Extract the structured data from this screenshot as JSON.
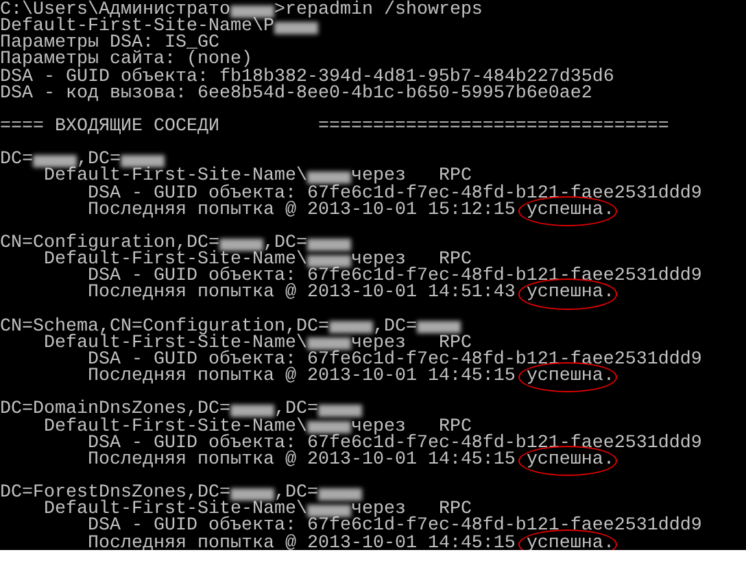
{
  "console": {
    "header": [
      [
        {
          "kind": "text",
          "text": "C:\\Users\\Администрато"
        },
        {
          "kind": "redaction"
        },
        {
          "kind": "text",
          "text": ">repadmin /showreps"
        }
      ],
      [
        {
          "kind": "text",
          "text": "Default-First-Site-Name\\P"
        },
        {
          "kind": "redaction"
        }
      ],
      [
        {
          "kind": "text",
          "text": "Параметры DSA: IS_GC"
        }
      ],
      [
        {
          "kind": "text",
          "text": "Параметры сайта: (none)"
        }
      ],
      [
        {
          "kind": "text",
          "text": "DSA - GUID объекта: fb18b382-394d-4d81-95b7-484b227d35d6"
        }
      ],
      [
        {
          "kind": "text",
          "text": "DSA - код вызова: 6ee8b54d-8ee0-4b1c-b650-59957b6e0ae2"
        }
      ]
    ],
    "section_title": "==== ВХОДЯЩИЕ СОСЕДИ         ================================",
    "neighbors": [
      {
        "naming_context": [
          {
            "kind": "text",
            "text": "DC="
          },
          {
            "kind": "redaction"
          },
          {
            "kind": "text",
            "text": ",DC="
          },
          {
            "kind": "redaction"
          }
        ],
        "source": [
          {
            "kind": "text",
            "text": "Default-First-Site-Name\\"
          },
          {
            "kind": "redaction"
          },
          {
            "kind": "text",
            "text": "через   RPC"
          }
        ],
        "guid": "DSA - GUID объекта: 67fe6c1d-f7ec-48fd-b121-faee2531ddd9",
        "attempt": "Последняя попытка @ 2013-10-01 15:12:15",
        "result": "успешна",
        "result_suffix": ".",
        "circled": true
      },
      {
        "naming_context": [
          {
            "kind": "text",
            "text": "CN=Configuration,DC="
          },
          {
            "kind": "redaction"
          },
          {
            "kind": "text",
            "text": ",DC="
          },
          {
            "kind": "redaction"
          }
        ],
        "source": [
          {
            "kind": "text",
            "text": "Default-First-Site-Name\\"
          },
          {
            "kind": "redaction"
          },
          {
            "kind": "text",
            "text": "через   RPC"
          }
        ],
        "guid": "DSA - GUID объекта: 67fe6c1d-f7ec-48fd-b121-faee2531ddd9",
        "attempt": "Последняя попытка @ 2013-10-01 14:51:43",
        "result": "успешна",
        "result_suffix": ".",
        "circled": true
      },
      {
        "naming_context": [
          {
            "kind": "text",
            "text": "CN=Schema,CN=Configuration,DC="
          },
          {
            "kind": "redaction"
          },
          {
            "kind": "text",
            "text": ",DC="
          },
          {
            "kind": "redaction"
          }
        ],
        "source": [
          {
            "kind": "text",
            "text": "Default-First-Site-Name\\"
          },
          {
            "kind": "redaction"
          },
          {
            "kind": "text",
            "text": "через   RPC"
          }
        ],
        "guid": "DSA - GUID объекта: 67fe6c1d-f7ec-48fd-b121-faee2531ddd9",
        "attempt": "Последняя попытка @ 2013-10-01 14:45:15",
        "result": "успешна",
        "result_suffix": ".",
        "circled": true
      },
      {
        "naming_context": [
          {
            "kind": "text",
            "text": "DC=DomainDnsZones,DC="
          },
          {
            "kind": "redaction"
          },
          {
            "kind": "text",
            "text": ",DC="
          },
          {
            "kind": "redaction"
          }
        ],
        "source": [
          {
            "kind": "text",
            "text": "Default-First-Site-Name\\"
          },
          {
            "kind": "redaction"
          },
          {
            "kind": "text",
            "text": "через   RPC"
          }
        ],
        "guid": "DSA - GUID объекта: 67fe6c1d-f7ec-48fd-b121-faee2531ddd9",
        "attempt": "Последняя попытка @ 2013-10-01 14:45:15",
        "result": "успешна",
        "result_suffix": ".",
        "circled": true
      },
      {
        "naming_context": [
          {
            "kind": "text",
            "text": "DC=ForestDnsZones,DC="
          },
          {
            "kind": "redaction"
          },
          {
            "kind": "text",
            "text": ",DC="
          },
          {
            "kind": "redaction"
          }
        ],
        "source": [
          {
            "kind": "text",
            "text": "Default-First-Site-Name\\"
          },
          {
            "kind": "redaction"
          },
          {
            "kind": "text",
            "text": "через   RPC"
          }
        ],
        "guid": "DSA - GUID объекта: 67fe6c1d-f7ec-48fd-b121-faee2531ddd9",
        "attempt": "Последняя попытка @ 2013-10-01 14:45:15",
        "result": "успешна",
        "result_suffix": ".",
        "circled": true
      }
    ]
  }
}
